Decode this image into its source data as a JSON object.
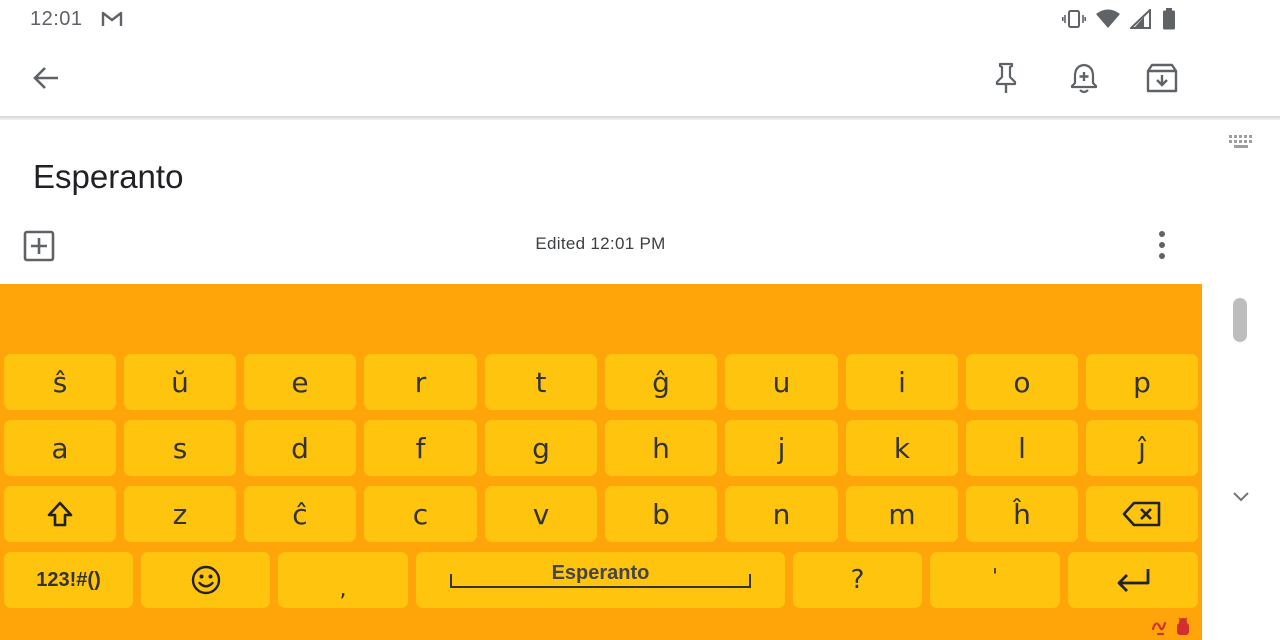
{
  "status_bar": {
    "time": "12:01"
  },
  "note": {
    "title": "Esperanto",
    "edited": "Edited 12:01 PM"
  },
  "keyboard": {
    "row1": [
      "ŝ",
      "ŭ",
      "e",
      "r",
      "t",
      "ĝ",
      "u",
      "i",
      "o",
      "p"
    ],
    "row2": [
      "a",
      "s",
      "d",
      "f",
      "g",
      "h",
      "j",
      "k",
      "l",
      "ĵ"
    ],
    "row3": [
      "z",
      "ĉ",
      "c",
      "v",
      "b",
      "n",
      "m",
      "ĥ"
    ],
    "symbols_label": "123!#()",
    "comma": ",",
    "space_label": "Esperanto",
    "question": "?",
    "apostrophe": "'"
  },
  "colors": {
    "keyboard_bg": "#ffa50a",
    "key_bg": "#ffc40d",
    "icon": "#5f6368"
  }
}
